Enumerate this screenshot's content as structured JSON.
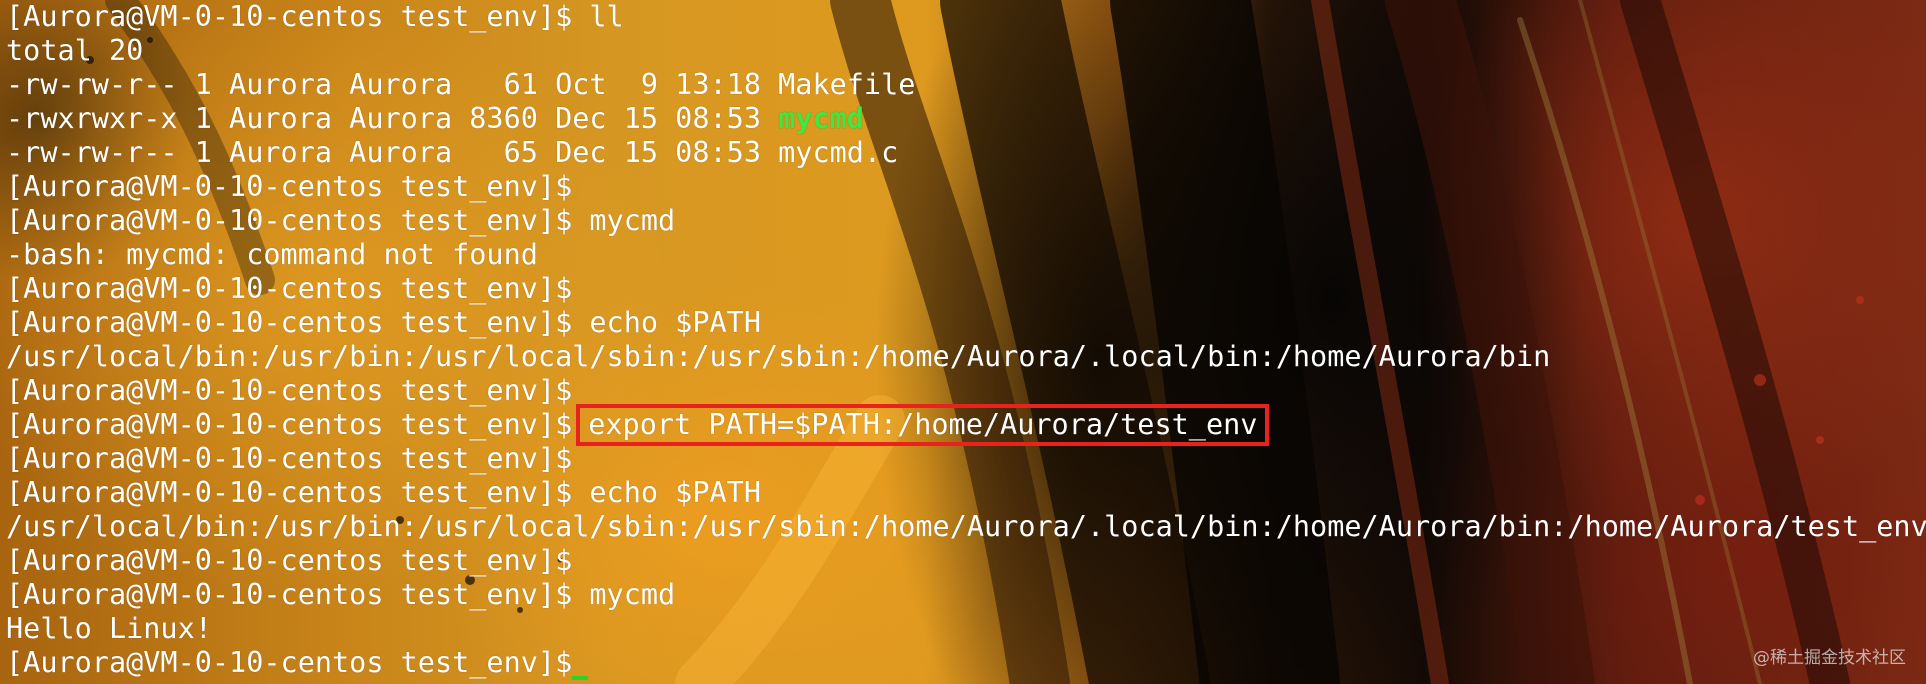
{
  "terminal": {
    "prompt": "[Aurora@VM-0-10-centos test_env]$",
    "lines": [
      {
        "kind": "prompt",
        "cmd": " ll"
      },
      {
        "kind": "out",
        "text": "total 20"
      },
      {
        "kind": "out",
        "text": "-rw-rw-r-- 1 Aurora Aurora   61 Oct  9 13:18 Makefile"
      },
      {
        "kind": "ls_exe",
        "text": "-rwxrwxr-x 1 Aurora Aurora 8360 Dec 15 08:53 ",
        "name": "mycmd"
      },
      {
        "kind": "out",
        "text": "-rw-rw-r-- 1 Aurora Aurora   65 Dec 15 08:53 mycmd.c"
      },
      {
        "kind": "prompt",
        "cmd": ""
      },
      {
        "kind": "prompt",
        "cmd": " mycmd"
      },
      {
        "kind": "out",
        "text": "-bash: mycmd: command not found"
      },
      {
        "kind": "prompt",
        "cmd": ""
      },
      {
        "kind": "prompt",
        "cmd": " echo $PATH"
      },
      {
        "kind": "out",
        "text": "/usr/local/bin:/usr/bin:/usr/local/sbin:/usr/sbin:/home/Aurora/.local/bin:/home/Aurora/bin"
      },
      {
        "kind": "prompt",
        "cmd": ""
      },
      {
        "kind": "prompt_hl",
        "cmd": "export PATH=$PATH:/home/Aurora/test_env"
      },
      {
        "kind": "prompt",
        "cmd": ""
      },
      {
        "kind": "prompt",
        "cmd": " echo $PATH"
      },
      {
        "kind": "out",
        "text": "/usr/local/bin:/usr/bin:/usr/local/sbin:/usr/sbin:/home/Aurora/.local/bin:/home/Aurora/bin:/home/Aurora/test_env"
      },
      {
        "kind": "prompt",
        "cmd": ""
      },
      {
        "kind": "prompt",
        "cmd": " mycmd"
      },
      {
        "kind": "out",
        "text": "Hello Linux!"
      },
      {
        "kind": "prompt_cursor",
        "cmd": ""
      }
    ]
  },
  "watermark": "@稀土掘金技术社区",
  "colors": {
    "text": "#ffffff",
    "executable": "#3ee83e",
    "highlight_border": "#e8221c"
  }
}
